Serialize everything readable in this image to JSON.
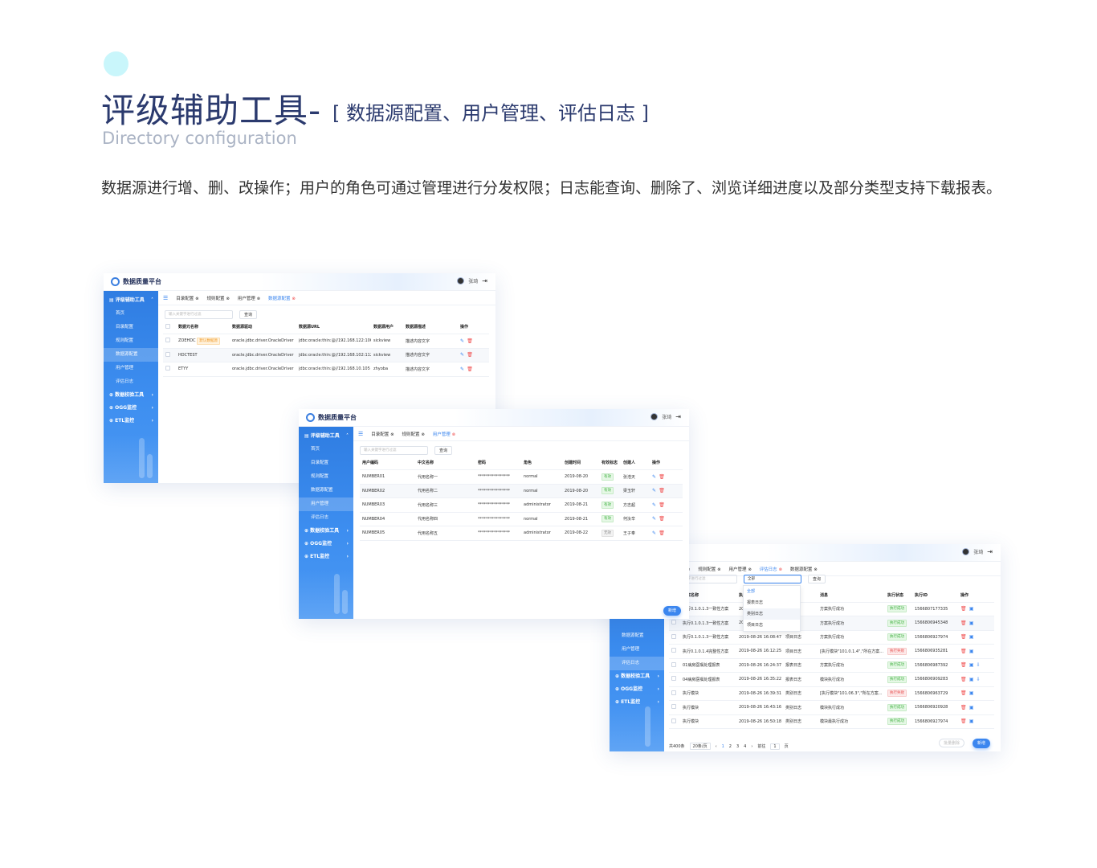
{
  "header": {
    "title": "评级辅助工具-",
    "subtitle": "[ 数据源配置、用户管理、评估日志 ]",
    "english": "Directory configuration",
    "description": "数据源进行增、删、改操作；用户的角色可通过管理进行分发权限；日志能查询、删除了、浏览详细进度以及部分类型支持下载报表。"
  },
  "app": {
    "logo_text": "数据质量平台",
    "user_name": "张琦",
    "logout_icon": "logout-icon",
    "sidebar": {
      "group_main": "评级辅助工具",
      "items": [
        "首页",
        "目录配置",
        "规则配置",
        "数据源配置",
        "用户管理",
        "评估日志"
      ],
      "group_check": "数据校验工具",
      "group_ogg": "OGG监控",
      "group_etl": "ETL监控"
    },
    "tabs": [
      "目录配置",
      "规则配置",
      "用户管理",
      "数据源配置",
      "评估日志"
    ],
    "search_placeholder": "输入关键字进行过滤",
    "query_label": "查询",
    "new_label": "新增",
    "batch_delete_label": "批量删除"
  },
  "datasource": {
    "columns": [
      "数据元名称",
      "数据源驱动",
      "数据源URL",
      "数据源用户",
      "数据源描述",
      "操作"
    ],
    "rows": [
      {
        "name": "ZOEHDC",
        "badge": "默认数据源",
        "driver": "oracle.jdbc.driver.OracleDriver",
        "url": "jdbc:oracle:thin:@//192.168.122:106",
        "user": "sickview",
        "desc": "描述内容文字"
      },
      {
        "name": "HDCTEST",
        "badge": "",
        "driver": "oracle.jdbc.driver.OracleDriver",
        "url": "jdbc:oracle:thin:@//192.168.102:112",
        "user": "sickview",
        "desc": "描述内容文字"
      },
      {
        "name": "ETYY",
        "badge": "",
        "driver": "oracle.jdbc.driver.OracleDriver",
        "url": "jdbc:oracle:thin:@//192.168.10.105",
        "user": "zhyoba",
        "desc": "描述内容文字"
      }
    ]
  },
  "users": {
    "columns": [
      "用户编码",
      "中文名称",
      "密码",
      "角色",
      "创建时间",
      "有效标志",
      "创建人",
      "操作"
    ],
    "rows": [
      {
        "code": "NUMBER01",
        "name": "代用名称一",
        "pwd": "****************",
        "role": "normal",
        "date": "2019-08-20",
        "flag": "有效",
        "flag_type": "ok",
        "creator": "张浩天"
      },
      {
        "code": "NUMBER02",
        "name": "代用名称二",
        "pwd": "****************",
        "role": "normal",
        "date": "2019-08-20",
        "flag": "有效",
        "flag_type": "ok",
        "creator": "梁玉轩"
      },
      {
        "code": "NUMBER03",
        "name": "代用名称三",
        "pwd": "****************",
        "role": "administrator",
        "date": "2019-08-21",
        "flag": "有效",
        "flag_type": "ok",
        "creator": "方志超"
      },
      {
        "code": "NUMBER04",
        "name": "代用名称四",
        "pwd": "****************",
        "role": "normal",
        "date": "2019-08-21",
        "flag": "有效",
        "flag_type": "ok",
        "creator": "何汝辛"
      },
      {
        "code": "NUMBER05",
        "name": "代用名称五",
        "pwd": "****************",
        "role": "administrator",
        "date": "2019-08-22",
        "flag": "无效",
        "flag_type": "no",
        "creator": "王子奉"
      }
    ]
  },
  "logs": {
    "filter_value": "全部",
    "filter_options": [
      "全部",
      "报表日志",
      "类别日志",
      "项目日志"
    ],
    "columns": [
      "方案名称",
      "执",
      "类",
      "消息",
      "执行状态",
      "执行ID",
      "操作"
    ],
    "rows": [
      {
        "plan": "执行0.1.0.1.3一致性方案",
        "time": "20",
        "type": "",
        "msg": "方案执行成功",
        "status": "执行成功",
        "st": "ok",
        "id": "1566807177335"
      },
      {
        "plan": "执行0.1.0.1.3一致性方案",
        "time": "20",
        "type": "",
        "msg": "方案执行成功",
        "status": "执行成功",
        "st": "ok",
        "id": "1566806945348"
      },
      {
        "plan": "执行0.1.0.1.3一致性方案",
        "time": "2019-08-26 16:08:47",
        "type": "项目日志",
        "msg": "方案执行成功",
        "status": "执行成功",
        "st": "ok",
        "id": "1566806927974"
      },
      {
        "plan": "执行0.1.0.1.4完整性方案",
        "time": "2019-08-26 16:12:25",
        "type": "项目日志",
        "msg": "[执行模块\"101.0.1.4\",\"所在方案...",
        "status": "执行失败",
        "st": "err",
        "id": "1566806935281"
      },
      {
        "plan": "01病房医嘱处理报表",
        "time": "2019-08-26 16:24:37",
        "type": "报表日志",
        "msg": "方案执行成功",
        "status": "执行成功",
        "st": "ok",
        "id": "1566806987392"
      },
      {
        "plan": "04病房医嘱处理报表",
        "time": "2019-08-26 16:35:22",
        "type": "报表日志",
        "msg": "模块执行成功",
        "status": "执行成功",
        "st": "ok",
        "id": "1566806909283"
      },
      {
        "plan": "执行模块",
        "time": "2019-08-26 16:39:31",
        "type": "类别日志",
        "msg": "[执行模块\"101.06.3\",\"所在方案...",
        "status": "执行失败",
        "st": "err",
        "id": "1566806963729"
      },
      {
        "plan": "执行模块",
        "time": "2019-08-26 16:43:16",
        "type": "类别日志",
        "msg": "模块执行成功",
        "status": "执行成功",
        "st": "ok",
        "id": "1566806920928"
      },
      {
        "plan": "执行模块",
        "time": "2019-08-26 16:50:18",
        "type": "类别日志",
        "msg": "模块最执行成功",
        "status": "执行成功",
        "st": "ok",
        "id": "1566806927974"
      }
    ],
    "pager": {
      "total": "共400条",
      "size": "20条/页",
      "pages": [
        "1",
        "2",
        "3",
        "4"
      ],
      "goto": "前往",
      "page_input": "1",
      "page_suffix": "页"
    }
  }
}
